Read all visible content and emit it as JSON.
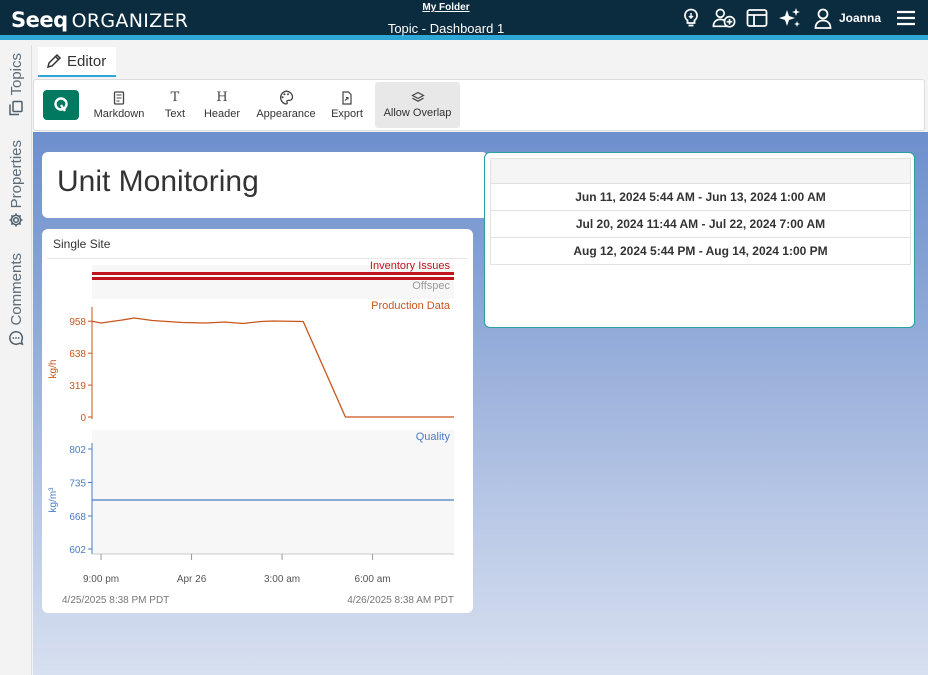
{
  "header": {
    "logo_main": "Seeq",
    "logo_sub": "ORGANIZER",
    "folder": "My Folder",
    "topic_title": "Topic - Dashboard 1",
    "user": "Joanna",
    "icons": [
      "lightbulb-icon",
      "add-user-icon",
      "layout-icon",
      "sparkle-icon",
      "user-icon",
      "menu-icon"
    ]
  },
  "rail": {
    "topics": "Topics",
    "properties": "Properties",
    "comments": "Comments"
  },
  "tab": {
    "editor": "Editor"
  },
  "toolbar": {
    "markdown": "Markdown",
    "text": "Text",
    "header": "Header",
    "appearance": "Appearance",
    "export": "Export",
    "allow_overlap": "Allow Overlap",
    "glyphs": {
      "text": "T",
      "header": "H"
    }
  },
  "title_card": {
    "title": "Unit Monitoring"
  },
  "condition_table": {
    "rows": [
      "Jun 11, 2024 5:44 AM - Jun 13, 2024 1:00 AM",
      "Jul 20, 2024 11:44 AM - Jul 22, 2024 7:00 AM",
      "Aug 12, 2024 5:44 PM - Aug 14, 2024 1:00 PM"
    ]
  },
  "chart_card": {
    "subtitle": "Single Site",
    "start_time": "4/25/2025 8:38 PM  PDT",
    "end_time": "4/26/2025 8:38 AM  PDT"
  },
  "chart_data": {
    "type": "line",
    "x_ticks": [
      "9:00 pm",
      "Apr 26",
      "3:00 am",
      "6:00 am"
    ],
    "conditions": [
      {
        "name": "Inventory Issues",
        "color": "#c0141e"
      },
      {
        "name": "Offspec",
        "color": "#9a9a9a"
      }
    ],
    "series": [
      {
        "name": "Production Data",
        "unit": "kg/h",
        "color": "#c8561a",
        "yticks": [
          0,
          319,
          638,
          958
        ],
        "ylim": [
          0,
          1000
        ],
        "x": [
          0,
          0.3,
          1,
          1.4,
          2,
          3,
          3.8,
          4.4,
          5,
          5.6,
          6,
          7,
          8.4,
          9,
          10.5,
          12
        ],
        "values": [
          958,
          940,
          970,
          990,
          965,
          945,
          940,
          950,
          935,
          955,
          960,
          955,
          0,
          0,
          0,
          0
        ]
      },
      {
        "name": "Quality",
        "unit": "kg/m³",
        "color": "#4a7cc4",
        "yticks": [
          602,
          668,
          735,
          802
        ],
        "ylim": [
          602,
          802
        ],
        "x": [
          0,
          12
        ],
        "values": [
          700,
          700
        ]
      }
    ]
  }
}
